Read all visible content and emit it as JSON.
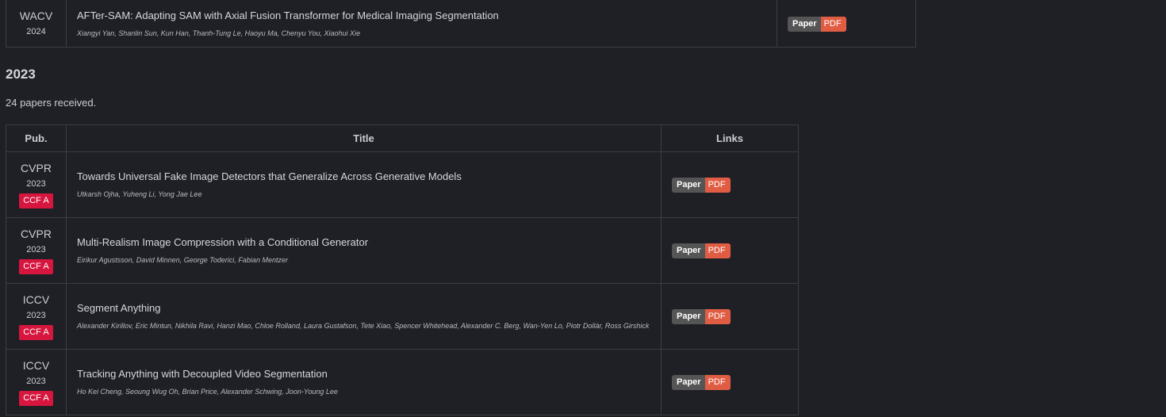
{
  "prev_section": {
    "row": {
      "pub": "WACV",
      "year": "2024",
      "title": "AFTer-SAM: Adapting SAM with Axial Fusion Transformer for Medical Imaging Segmentation",
      "authors": "Xiangyi Yan, Shanlin Sun, Kun Han, Thanh-Tung Le, Haoyu Ma, Chenyu You, Xiaohui Xie",
      "badge_left": "Paper",
      "badge_right": "PDF"
    }
  },
  "section": {
    "heading": "2023",
    "count_text": "24 papers received."
  },
  "table": {
    "headers": {
      "pub": "Pub.",
      "title": "Title",
      "links": "Links"
    },
    "rows": [
      {
        "pub": "CVPR",
        "year": "2023",
        "ccf": "CCF A",
        "title": "Towards Universal Fake Image Detectors that Generalize Across Generative Models",
        "authors": "Utkarsh Ojha, Yuheng Li, Yong Jae Lee",
        "badge_left": "Paper",
        "badge_right": "PDF"
      },
      {
        "pub": "CVPR",
        "year": "2023",
        "ccf": "CCF A",
        "title": "Multi-Realism Image Compression with a Conditional Generator",
        "authors": "Eirikur Agustsson, David Minnen, George Toderici, Fabian Mentzer",
        "badge_left": "Paper",
        "badge_right": "PDF"
      },
      {
        "pub": "ICCV",
        "year": "2023",
        "ccf": "CCF A",
        "title": "Segment Anything",
        "authors": "Alexander Kirillov, Eric Mintun, Nikhila Ravi, Hanzi Mao, Chloe Rolland, Laura Gustafson, Tete Xiao, Spencer Whitehead, Alexander C. Berg, Wan-Yen Lo, Piotr Dollár, Ross Girshick",
        "badge_left": "Paper",
        "badge_right": "PDF"
      },
      {
        "pub": "ICCV",
        "year": "2023",
        "ccf": "CCF A",
        "title": "Tracking Anything with Decoupled Video Segmentation",
        "authors": "Ho Kei Cheng, Seoung Wug Oh, Brian Price, Alexander Schwing, Joon-Young Lee",
        "badge_left": "Paper",
        "badge_right": "PDF"
      }
    ]
  },
  "colors": {
    "background": "#1f2025",
    "ccf_badge": "#d6163f",
    "badge_left": "#555555",
    "badge_right": "#e05d44"
  }
}
